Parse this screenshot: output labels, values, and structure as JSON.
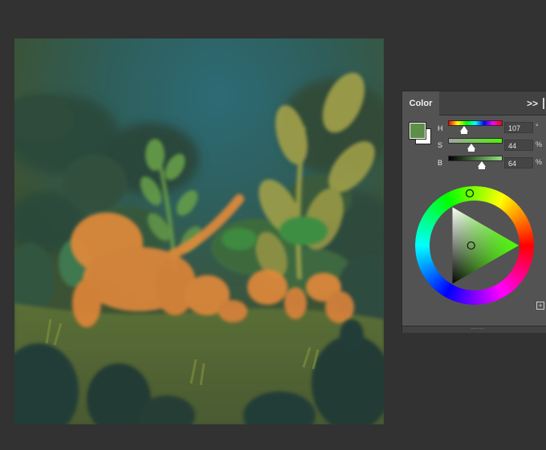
{
  "panel": {
    "tab_label": "Color",
    "collapse_label": ">>",
    "foreground_color": "#5e8f48",
    "background_color": "#ffffff"
  },
  "sliders": {
    "h": {
      "label": "H",
      "value": "107",
      "unit": "°"
    },
    "s": {
      "label": "S",
      "value": "44",
      "unit": "%"
    },
    "b": {
      "label": "B",
      "value": "64",
      "unit": "%"
    }
  },
  "wheel": {
    "hue_color": "#4cff00"
  },
  "add_button_label": "+"
}
